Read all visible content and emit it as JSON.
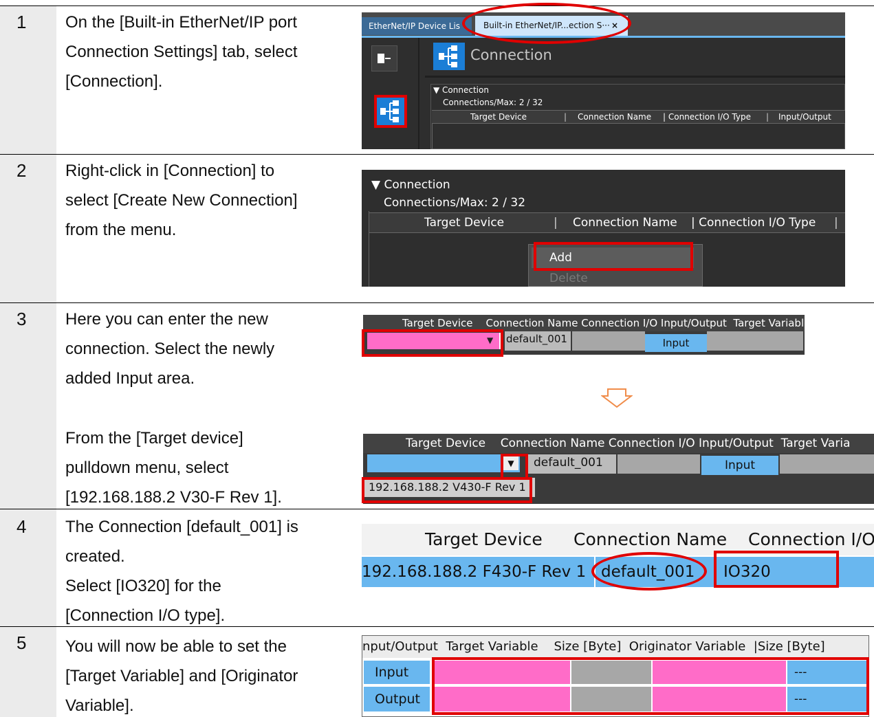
{
  "steps": [
    {
      "number": "1",
      "lines": [
        "On the [Built-in EtherNet/IP port",
        "Connection Settings] tab, select",
        "[Connection]."
      ]
    },
    {
      "number": "2",
      "lines": [
        "Right-click in [Connection] to",
        "select [Create New Connection]",
        "from the menu."
      ]
    },
    {
      "number": "3",
      "lines": [
        "Here you can enter the new",
        "connection. Select the newly",
        "added Input area."
      ],
      "lines_b": [
        "From the [Target device]",
        "pulldown menu, select",
        "[192.168.188.2 V30-F Rev 1]."
      ]
    },
    {
      "number": "4",
      "lines": [
        "The Connection [default_001] is",
        "created.",
        "Select [IO320] for the",
        "[Connection I/O type]."
      ]
    },
    {
      "number": "5",
      "lines": [
        "You will now be able to set the",
        "[Target Variable] and [Originator",
        "Variable]."
      ]
    }
  ],
  "shot1": {
    "tab_inactive": "EtherNet/IP Device Lis",
    "tab_active": "Built-in EtherNet/IP...ection S···",
    "tab_close": "×",
    "section_title": "Connection",
    "group_title": "▼ Connection",
    "count": "Connections/Max: 2 / 32",
    "headers": [
      "Target Device",
      "|",
      "Connection Name",
      "| Connection I/O Type",
      "|",
      "Input/Output"
    ]
  },
  "shot2": {
    "group_title": "▼ Connection",
    "count": "Connections/Max: 2 / 32",
    "headers": [
      "Target Device",
      "|",
      "Connection Name",
      "| Connection I/O Type",
      "|"
    ],
    "menu_add": "Add",
    "menu_delete": "Delete"
  },
  "shot3a": {
    "headers": "Target Device    Connection Name Connection I/O Input/Output  Target Variable",
    "connection_name": "default_001",
    "io": "Input"
  },
  "shot3b": {
    "headers": "Target Device    Connection Name Connection I/O Input/Output  Target Varia",
    "connection_name": "default_001",
    "io": "Input",
    "dropdown_option": "192.168.188.2 V430-F Rev 1"
  },
  "shot4": {
    "headers": [
      "Target Device",
      "Connection Name",
      "Connection I/O"
    ],
    "target_device": "192.168.188.2 F430-F Rev 1",
    "connection_name": "default_001",
    "io_type": "IO320"
  },
  "shot5": {
    "headers": "nput/Output  Target Variable    Size [Byte]  Originator Variable  |Size [Byte]",
    "rows": [
      {
        "io": "Input",
        "size": "---"
      },
      {
        "io": "Output",
        "size": "---"
      }
    ]
  },
  "colors": {
    "accent_red": "#e00000",
    "ui_blue": "#69b7ef",
    "ui_pink": "#ff6cc8",
    "ui_dark": "#2e2e2e"
  }
}
